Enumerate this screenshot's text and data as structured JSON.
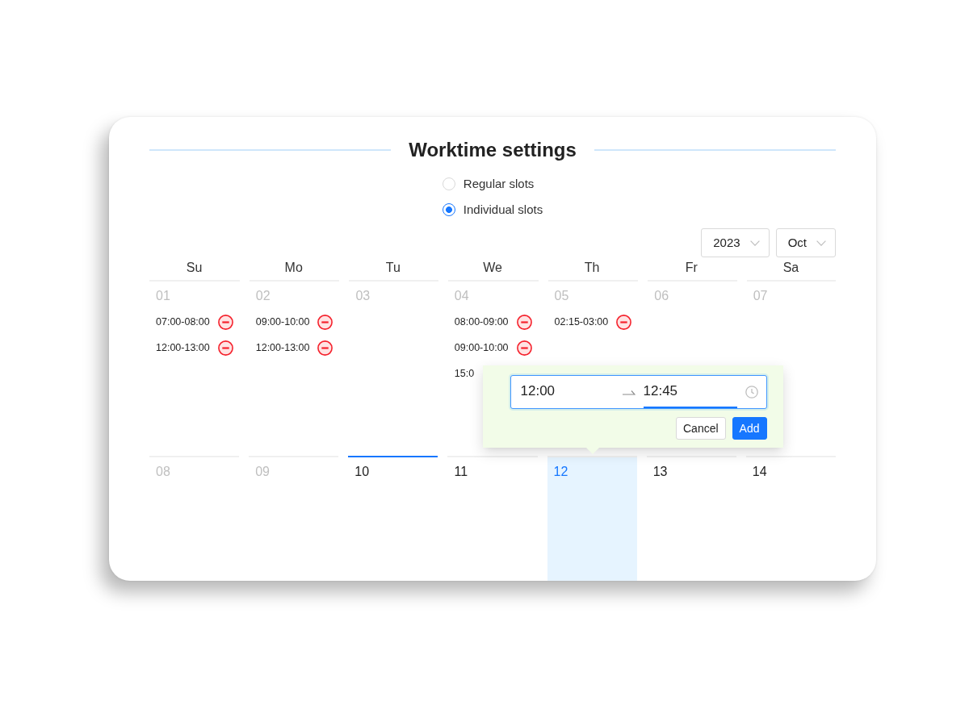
{
  "title": "Worktime settings",
  "mode_options": [
    {
      "label": "Regular slots",
      "selected": false
    },
    {
      "label": "Individual slots",
      "selected": true
    }
  ],
  "year_select": {
    "value": "2023"
  },
  "month_select": {
    "value": "Oct"
  },
  "weekdays": [
    "Su",
    "Mo",
    "Tu",
    "We",
    "Th",
    "Fr",
    "Sa"
  ],
  "weeks": [
    [
      {
        "date": "01",
        "past": true,
        "today": false,
        "selected": false,
        "slots": [
          {
            "kind": "slot",
            "time": "07:00-08:00"
          },
          {
            "kind": "slot",
            "time": "12:00-13:00"
          }
        ]
      },
      {
        "date": "02",
        "past": true,
        "today": false,
        "selected": false,
        "slots": [
          {
            "kind": "slot",
            "time": "09:00-10:00"
          },
          {
            "kind": "slot",
            "time": "12:00-13:00"
          }
        ]
      },
      {
        "date": "03",
        "past": true,
        "today": false,
        "selected": false
      },
      {
        "date": "04",
        "past": true,
        "today": false,
        "selected": false,
        "slots": [
          {
            "kind": "slot",
            "time": "08:00-09:00"
          },
          {
            "kind": "slot",
            "time": "09:00-10:00"
          },
          {
            "kind": "clipped",
            "time": "15:0"
          }
        ]
      },
      {
        "date": "05",
        "past": true,
        "today": false,
        "selected": false,
        "slots": [
          {
            "kind": "slot",
            "time": "02:15-03:00"
          }
        ]
      },
      {
        "date": "06",
        "past": true,
        "today": false,
        "selected": false
      },
      {
        "date": "07",
        "past": true,
        "today": false,
        "selected": false
      }
    ],
    [
      {
        "date": "08",
        "past": true,
        "today": false,
        "selected": false
      },
      {
        "date": "09",
        "past": true,
        "today": false,
        "selected": false
      },
      {
        "date": "10",
        "past": false,
        "today": true,
        "selected": false
      },
      {
        "date": "11",
        "past": false,
        "today": false,
        "selected": false
      },
      {
        "date": "12",
        "past": false,
        "today": false,
        "selected": true
      },
      {
        "date": "13",
        "past": false,
        "today": false,
        "selected": false
      },
      {
        "date": "14",
        "past": false,
        "today": false,
        "selected": false
      }
    ]
  ],
  "popover": {
    "start": {
      "value": "12:00",
      "active": false
    },
    "end": {
      "value": "12:45",
      "active": true
    },
    "buttons": [
      {
        "label": "Cancel",
        "kind": "default"
      },
      {
        "label": "Add",
        "kind": "primary"
      }
    ]
  }
}
